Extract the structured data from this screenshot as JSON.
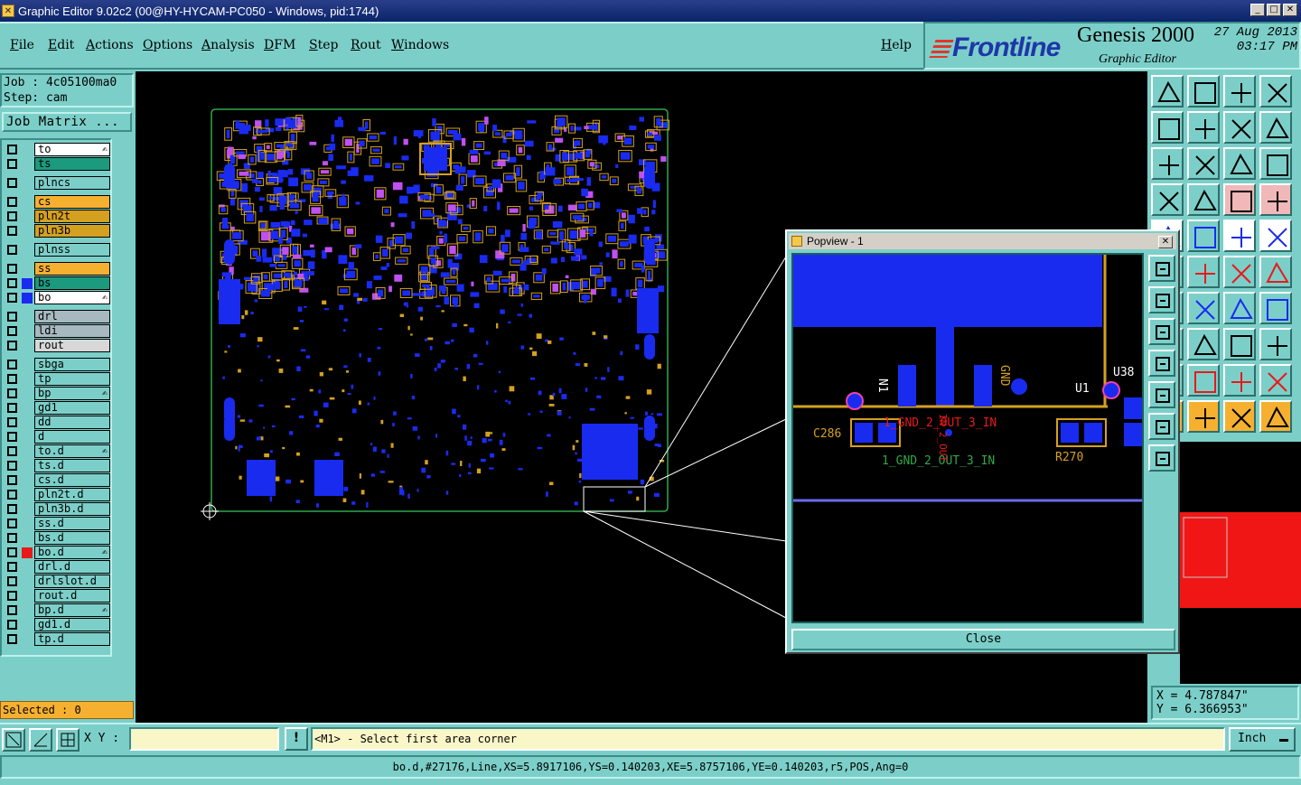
{
  "window": {
    "title": "Graphic Editor 9.02c2 (00@HY-HYCAM-PC050 - Windows, pid:1744)"
  },
  "menu": [
    "File",
    "Edit",
    "Actions",
    "Options",
    "Analysis",
    "DFM",
    "Step",
    "Rout",
    "Windows"
  ],
  "help": "Help",
  "brand": {
    "logo": "Frontline",
    "product": "Genesis 2000",
    "subtitle": "Graphic Editor",
    "date": "27 Aug 2013",
    "time": "03:17 PM"
  },
  "job": {
    "job_line": "Job : 4c05100ma0",
    "step_line": "Step: cam",
    "matrix_button": "Job Matrix ..."
  },
  "layers": [
    {
      "name": "to",
      "bg": "#ffffff",
      "swatch": "",
      "edit": true
    },
    {
      "name": "ts",
      "bg": "#1c9a7e",
      "swatch": "",
      "edit": false
    },
    {
      "name": "plncs",
      "bg": "#7ccfc9",
      "swatch": "",
      "edit": false
    },
    {
      "name": "cs",
      "bg": "#f6b030",
      "swatch": "",
      "edit": false
    },
    {
      "name": "pln2t",
      "bg": "#d4a020",
      "swatch": "",
      "edit": false
    },
    {
      "name": "pln3b",
      "bg": "#d4a020",
      "swatch": "",
      "edit": false
    },
    {
      "name": "plnss",
      "bg": "#7ccfc9",
      "swatch": "",
      "edit": false
    },
    {
      "name": "ss",
      "bg": "#f6b030",
      "swatch": "",
      "edit": false
    },
    {
      "name": "bs",
      "bg": "#1c9a7e",
      "swatch": "#1a2bf0",
      "edit": false
    },
    {
      "name": "bo",
      "bg": "#ffffff",
      "swatch": "#1a2bf0",
      "edit": true
    },
    {
      "name": "drl",
      "bg": "#a8b8c0",
      "swatch": "",
      "edit": false
    },
    {
      "name": "ldi",
      "bg": "#a8b8c0",
      "swatch": "",
      "edit": false
    },
    {
      "name": "rout",
      "bg": "#d8d8d8",
      "swatch": "",
      "edit": false
    },
    {
      "name": "sbga",
      "bg": "#7ccfc9",
      "swatch": "",
      "edit": false
    },
    {
      "name": "tp",
      "bg": "#7ccfc9",
      "swatch": "",
      "edit": false
    },
    {
      "name": "bp",
      "bg": "#7ccfc9",
      "swatch": "",
      "edit": true
    },
    {
      "name": "gd1",
      "bg": "#7ccfc9",
      "swatch": "",
      "edit": false
    },
    {
      "name": "dd",
      "bg": "#7ccfc9",
      "swatch": "",
      "edit": false
    },
    {
      "name": "d",
      "bg": "#7ccfc9",
      "swatch": "",
      "edit": false
    },
    {
      "name": "to.d",
      "bg": "#7ccfc9",
      "swatch": "",
      "edit": true
    },
    {
      "name": "ts.d",
      "bg": "#7ccfc9",
      "swatch": "",
      "edit": false
    },
    {
      "name": "cs.d",
      "bg": "#7ccfc9",
      "swatch": "",
      "edit": false
    },
    {
      "name": "pln2t.d",
      "bg": "#7ccfc9",
      "swatch": "",
      "edit": false
    },
    {
      "name": "pln3b.d",
      "bg": "#7ccfc9",
      "swatch": "",
      "edit": false
    },
    {
      "name": "ss.d",
      "bg": "#7ccfc9",
      "swatch": "",
      "edit": false
    },
    {
      "name": "bs.d",
      "bg": "#7ccfc9",
      "swatch": "",
      "edit": false
    },
    {
      "name": "bo.d",
      "bg": "#7ccfc9",
      "swatch": "#e81a1a",
      "edit": true
    },
    {
      "name": "drl.d",
      "bg": "#7ccfc9",
      "swatch": "",
      "edit": false
    },
    {
      "name": "drlslot.d",
      "bg": "#7ccfc9",
      "swatch": "",
      "edit": false
    },
    {
      "name": "rout.d",
      "bg": "#7ccfc9",
      "swatch": "",
      "edit": false
    },
    {
      "name": "bp.d",
      "bg": "#7ccfc9",
      "swatch": "",
      "edit": true
    },
    {
      "name": "gd1.d",
      "bg": "#7ccfc9",
      "swatch": "",
      "edit": false
    },
    {
      "name": "tp.d",
      "bg": "#7ccfc9",
      "swatch": "",
      "edit": false
    }
  ],
  "selected": "Selected : 0",
  "popview": {
    "title": "Popview - 1",
    "close_label": "Close",
    "labels": [
      "N1",
      "GND",
      "U38",
      "C286",
      "R270",
      "1_GND_2_OUT_3_IN",
      "1_GND_2_OUT_3_IN",
      "IN_2_OUT",
      "U1"
    ]
  },
  "coords": {
    "x": "X = 4.787847\"",
    "y": "Y = 6.366953\""
  },
  "bottom": {
    "xy_label": "X Y :",
    "xy_value": "",
    "prompt": "<M1> - Select first area corner",
    "units": "Inch",
    "status": "bo.d,#27176,Line,XS=5.8917106,YS=0.140203,XE=5.8757106,YE=0.140203,r5,POS,Ang=0"
  },
  "colors": {
    "app_bg": "#7ccfc9",
    "copper": "#1a2bf0",
    "silk": "#d4a020",
    "highlight": "#e81a1a"
  }
}
